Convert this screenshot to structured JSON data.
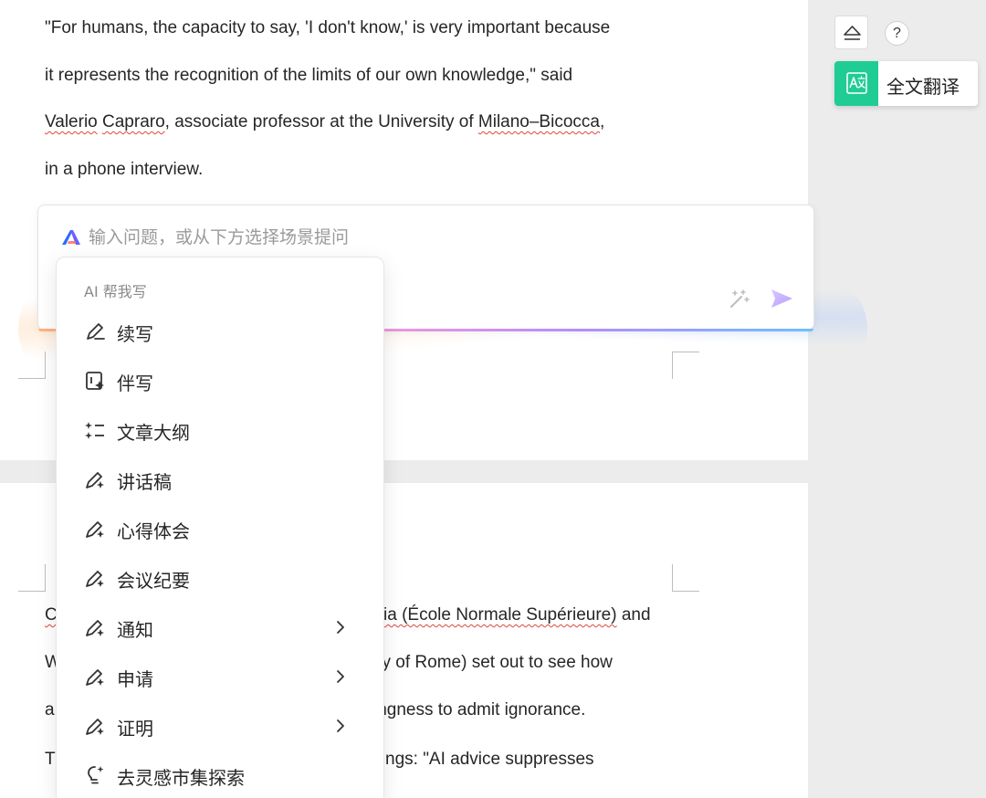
{
  "document": {
    "paragraph1": {
      "line1": "\"For humans, the capacity to say, 'I don't know,' is very important because",
      "line2": "it represents the recognition of the limits of our own knowledge,\" said",
      "line3_name1": "Valerio",
      "line3_name2": "Capraro",
      "line3_mid": ", associate professor at the University of ",
      "line3_place": "Milano–Bicocca",
      "line3_end": ",",
      "line4": "in a phone interview."
    },
    "paragraph2": {
      "line1_start": "C",
      "line1_squig": "ia (École Normale Supérieure)",
      "line1_end": " and",
      "line2_start": "W",
      "line2_end": "ity of Rome) set out to see how",
      "line3_start": "a",
      "line3_end": "ingness to admit ignorance.",
      "line4_start": "T",
      "line4_end": "ngs: \"AI advice suppresses"
    }
  },
  "ai_panel": {
    "placeholder": "输入问题，或从下方选择场景提问",
    "accent_colors": [
      "#ffb37a",
      "#f49bd6",
      "#b58cff",
      "#6cc0ff"
    ]
  },
  "menu": {
    "header": "AI 帮我写",
    "items": [
      {
        "label": "续写",
        "icon": "pen-icon"
      },
      {
        "label": "伴写",
        "icon": "companion-write-icon"
      },
      {
        "label": "文章大纲",
        "icon": "outline-icon"
      },
      {
        "label": "讲话稿",
        "icon": "ai-pen-icon"
      },
      {
        "label": "心得体会",
        "icon": "ai-pen-icon"
      },
      {
        "label": "会议纪要",
        "icon": "ai-pen-icon"
      },
      {
        "label": "通知",
        "icon": "ai-pen-icon",
        "submenu": true
      },
      {
        "label": "申请",
        "icon": "ai-pen-icon",
        "submenu": true
      },
      {
        "label": "证明",
        "icon": "ai-pen-icon",
        "submenu": true
      },
      {
        "label": "去灵感市集探索",
        "icon": "lightbulb-icon"
      }
    ]
  },
  "right_panel": {
    "help_label": "?",
    "translate_label": "全文翻译",
    "translate_color": "#1fcc94"
  }
}
